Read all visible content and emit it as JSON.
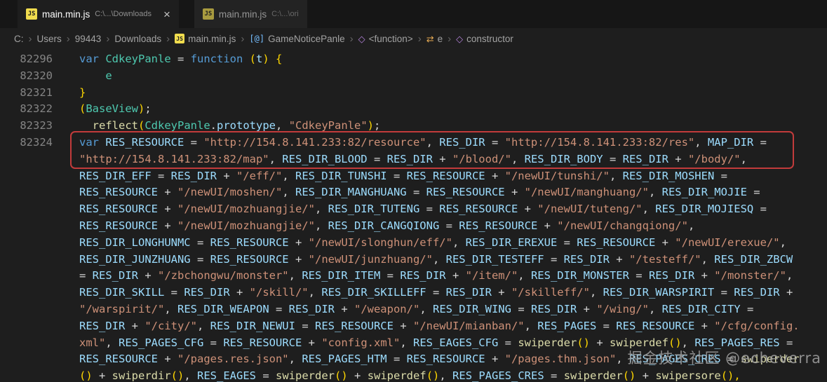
{
  "tabs": [
    {
      "label": "main.min.js",
      "path": "C:\\...\\Downloads",
      "close": "×",
      "active": true,
      "icon": "js"
    },
    {
      "label": "main.min.js",
      "path": "C:\\...\\ori",
      "active": false,
      "icon": "js"
    }
  ],
  "icons": {
    "js": "JS",
    "class": "[@]",
    "cube": "◇",
    "symbol": "⇄"
  },
  "breadcrumb": {
    "separator": "›",
    "items": [
      {
        "label": "C:"
      },
      {
        "label": "Users"
      },
      {
        "label": "99443"
      },
      {
        "label": "Downloads"
      },
      {
        "label": "main.min.js",
        "icon": "js"
      },
      {
        "label": "GameNoticePanle",
        "icon": "class"
      },
      {
        "label": "<function>",
        "icon": "cube"
      },
      {
        "label": "e",
        "icon": "symbol"
      },
      {
        "label": "constructor",
        "icon": "cube"
      }
    ]
  },
  "code": {
    "lines": [
      {
        "num": "82296",
        "tokens": [
          [
            "kw",
            "var "
          ],
          [
            "cls",
            "CdkeyPanle "
          ],
          [
            "op",
            "= "
          ],
          [
            "kw",
            "function "
          ],
          [
            "br",
            "("
          ],
          [
            "var",
            "t"
          ],
          [
            "br",
            ") "
          ],
          [
            "br",
            "{"
          ]
        ]
      },
      {
        "num": "82320",
        "tokens": [
          [
            "pl",
            "    "
          ],
          [
            "cls",
            "e"
          ]
        ]
      },
      {
        "num": "82321",
        "tokens": [
          [
            "br",
            "}"
          ]
        ]
      },
      {
        "num": "82322",
        "tokens": [
          [
            "br",
            "("
          ],
          [
            "cls",
            "BaseView"
          ],
          [
            "br",
            ")"
          ],
          [
            "pl",
            ";"
          ]
        ]
      },
      {
        "num": "82323",
        "tokens": [
          [
            "fn",
            "__reflect"
          ],
          [
            "br",
            "("
          ],
          [
            "cls",
            "CdkeyPanle"
          ],
          [
            "pl",
            "."
          ],
          [
            "var",
            "prototype"
          ],
          [
            "pl",
            ", "
          ],
          [
            "str",
            "\"CdkeyPanle\""
          ],
          [
            "br",
            ")"
          ],
          [
            "pl",
            ";"
          ]
        ]
      },
      {
        "num": "82324",
        "tokens": [
          [
            "kw",
            "var "
          ],
          [
            "var",
            "RES_RESOURCE "
          ],
          [
            "op",
            "= "
          ],
          [
            "str",
            "\"http://154.8.141.233:82/resource\""
          ],
          [
            "pl",
            ", "
          ],
          [
            "var",
            "RES_DIR "
          ],
          [
            "op",
            "= "
          ],
          [
            "str",
            "\"http://154.8.141.233:82/res\""
          ],
          [
            "pl",
            ", "
          ],
          [
            "var",
            "MAP_DIR "
          ],
          [
            "op",
            "="
          ]
        ]
      },
      {
        "num": "",
        "tokens": [
          [
            "str",
            "\"http://154.8.141.233:82/map\""
          ],
          [
            "pl",
            ", "
          ],
          [
            "var",
            "RES_DIR_BLOOD "
          ],
          [
            "op",
            "= "
          ],
          [
            "var",
            "RES_DIR "
          ],
          [
            "op",
            "+ "
          ],
          [
            "str",
            "\"/blood/\""
          ],
          [
            "pl",
            ", "
          ],
          [
            "var",
            "RES_DIR_BODY "
          ],
          [
            "op",
            "= "
          ],
          [
            "var",
            "RES_DIR "
          ],
          [
            "op",
            "+ "
          ],
          [
            "str",
            "\"/body/\""
          ],
          [
            "pl",
            ","
          ]
        ]
      },
      {
        "num": "",
        "tokens": [
          [
            "var",
            "RES_DIR_EFF "
          ],
          [
            "op",
            "= "
          ],
          [
            "var",
            "RES_DIR "
          ],
          [
            "op",
            "+ "
          ],
          [
            "str",
            "\"/eff/\""
          ],
          [
            "pl",
            ", "
          ],
          [
            "var",
            "RES_DIR_TUNSHI "
          ],
          [
            "op",
            "= "
          ],
          [
            "var",
            "RES_RESOURCE "
          ],
          [
            "op",
            "+ "
          ],
          [
            "str",
            "\"/newUI/tunshi/\""
          ],
          [
            "pl",
            ", "
          ],
          [
            "var",
            "RES_DIR_MOSHEN "
          ],
          [
            "op",
            "="
          ]
        ]
      },
      {
        "num": "",
        "tokens": [
          [
            "var",
            "RES_RESOURCE "
          ],
          [
            "op",
            "+ "
          ],
          [
            "str",
            "\"/newUI/moshen/\""
          ],
          [
            "pl",
            ", "
          ],
          [
            "var",
            "RES_DIR_MANGHUANG "
          ],
          [
            "op",
            "= "
          ],
          [
            "var",
            "RES_RESOURCE "
          ],
          [
            "op",
            "+ "
          ],
          [
            "str",
            "\"/newUI/manghuang/\""
          ],
          [
            "pl",
            ", "
          ],
          [
            "var",
            "RES_DIR_MOJIE "
          ],
          [
            "op",
            "="
          ]
        ]
      },
      {
        "num": "",
        "tokens": [
          [
            "var",
            "RES_RESOURCE "
          ],
          [
            "op",
            "+ "
          ],
          [
            "str",
            "\"/newUI/mozhuangjie/\""
          ],
          [
            "pl",
            ", "
          ],
          [
            "var",
            "RES_DIR_TUTENG "
          ],
          [
            "op",
            "= "
          ],
          [
            "var",
            "RES_RESOURCE "
          ],
          [
            "op",
            "+ "
          ],
          [
            "str",
            "\"/newUI/tuteng/\""
          ],
          [
            "pl",
            ", "
          ],
          [
            "var",
            "RES_DIR_MOJIESQ "
          ],
          [
            "op",
            "="
          ]
        ]
      },
      {
        "num": "",
        "tokens": [
          [
            "var",
            "RES_RESOURCE "
          ],
          [
            "op",
            "+ "
          ],
          [
            "str",
            "\"/newUI/mozhuangjie/\""
          ],
          [
            "pl",
            ", "
          ],
          [
            "var",
            "RES_DIR_CANGQIONG "
          ],
          [
            "op",
            "= "
          ],
          [
            "var",
            "RES_RESOURCE "
          ],
          [
            "op",
            "+ "
          ],
          [
            "str",
            "\"/newUI/changqiong/\""
          ],
          [
            "pl",
            ","
          ]
        ]
      },
      {
        "num": "",
        "tokens": [
          [
            "var",
            "RES_DIR_LONGHUNMC "
          ],
          [
            "op",
            "= "
          ],
          [
            "var",
            "RES_RESOURCE "
          ],
          [
            "op",
            "+ "
          ],
          [
            "str",
            "\"/newUI/slonghun/eff/\""
          ],
          [
            "pl",
            ", "
          ],
          [
            "var",
            "RES_DIR_EREXUE "
          ],
          [
            "op",
            "= "
          ],
          [
            "var",
            "RES_RESOURCE "
          ],
          [
            "op",
            "+ "
          ],
          [
            "str",
            "\"/newUI/erexue/\""
          ],
          [
            "pl",
            ","
          ]
        ]
      },
      {
        "num": "",
        "tokens": [
          [
            "var",
            "RES_DIR_JUNZHUANG "
          ],
          [
            "op",
            "= "
          ],
          [
            "var",
            "RES_RESOURCE "
          ],
          [
            "op",
            "+ "
          ],
          [
            "str",
            "\"/newUI/junzhuang/\""
          ],
          [
            "pl",
            ", "
          ],
          [
            "var",
            "RES_DIR_TESTEFF "
          ],
          [
            "op",
            "= "
          ],
          [
            "var",
            "RES_DIR "
          ],
          [
            "op",
            "+ "
          ],
          [
            "str",
            "\"/testeff/\""
          ],
          [
            "pl",
            ", "
          ],
          [
            "var",
            "RES_DIR_ZBCW"
          ]
        ]
      },
      {
        "num": "",
        "tokens": [
          [
            "op",
            "= "
          ],
          [
            "var",
            "RES_DIR "
          ],
          [
            "op",
            "+ "
          ],
          [
            "str",
            "\"/zbchongwu/monster\""
          ],
          [
            "pl",
            ", "
          ],
          [
            "var",
            "RES_DIR_ITEM "
          ],
          [
            "op",
            "= "
          ],
          [
            "var",
            "RES_DIR "
          ],
          [
            "op",
            "+ "
          ],
          [
            "str",
            "\"/item/\""
          ],
          [
            "pl",
            ", "
          ],
          [
            "var",
            "RES_DIR_MONSTER "
          ],
          [
            "op",
            "= "
          ],
          [
            "var",
            "RES_DIR "
          ],
          [
            "op",
            "+ "
          ],
          [
            "str",
            "\"/monster/\""
          ],
          [
            "pl",
            ","
          ]
        ]
      },
      {
        "num": "",
        "tokens": [
          [
            "var",
            "RES_DIR_SKILL "
          ],
          [
            "op",
            "= "
          ],
          [
            "var",
            "RES_DIR "
          ],
          [
            "op",
            "+ "
          ],
          [
            "str",
            "\"/skill/\""
          ],
          [
            "pl",
            ", "
          ],
          [
            "var",
            "RES_DIR_SKILLEFF "
          ],
          [
            "op",
            "= "
          ],
          [
            "var",
            "RES_DIR "
          ],
          [
            "op",
            "+ "
          ],
          [
            "str",
            "\"/skilleff/\""
          ],
          [
            "pl",
            ", "
          ],
          [
            "var",
            "RES_DIR_WARSPIRIT "
          ],
          [
            "op",
            "= "
          ],
          [
            "var",
            "RES_DIR "
          ],
          [
            "op",
            "+"
          ]
        ]
      },
      {
        "num": "",
        "tokens": [
          [
            "str",
            "\"/warspirit/\""
          ],
          [
            "pl",
            ", "
          ],
          [
            "var",
            "RES_DIR_WEAPON "
          ],
          [
            "op",
            "= "
          ],
          [
            "var",
            "RES_DIR "
          ],
          [
            "op",
            "+ "
          ],
          [
            "str",
            "\"/weapon/\""
          ],
          [
            "pl",
            ", "
          ],
          [
            "var",
            "RES_DIR_WING "
          ],
          [
            "op",
            "= "
          ],
          [
            "var",
            "RES_DIR "
          ],
          [
            "op",
            "+ "
          ],
          [
            "str",
            "\"/wing/\""
          ],
          [
            "pl",
            ", "
          ],
          [
            "var",
            "RES_DIR_CITY "
          ],
          [
            "op",
            "="
          ]
        ]
      },
      {
        "num": "",
        "tokens": [
          [
            "var",
            "RES_DIR "
          ],
          [
            "op",
            "+ "
          ],
          [
            "str",
            "\"/city/\""
          ],
          [
            "pl",
            ", "
          ],
          [
            "var",
            "RES_DIR_NEWUI "
          ],
          [
            "op",
            "= "
          ],
          [
            "var",
            "RES_RESOURCE "
          ],
          [
            "op",
            "+ "
          ],
          [
            "str",
            "\"/newUI/mianban/\""
          ],
          [
            "pl",
            ", "
          ],
          [
            "var",
            "RES_PAGES "
          ],
          [
            "op",
            "= "
          ],
          [
            "var",
            "RES_RESOURCE "
          ],
          [
            "op",
            "+ "
          ],
          [
            "str",
            "\"/cfg/config."
          ]
        ]
      },
      {
        "num": "",
        "tokens": [
          [
            "str",
            "xml\""
          ],
          [
            "pl",
            ", "
          ],
          [
            "var",
            "RES_PAGES_CFG "
          ],
          [
            "op",
            "= "
          ],
          [
            "var",
            "RES_RESOURCE "
          ],
          [
            "op",
            "+ "
          ],
          [
            "str",
            "\"config.xml\""
          ],
          [
            "pl",
            ", "
          ],
          [
            "var",
            "RES_EAGES_CFG "
          ],
          [
            "op",
            "= "
          ],
          [
            "fn",
            "swiperder"
          ],
          [
            "br",
            "()"
          ],
          [
            "op",
            " + "
          ],
          [
            "fn",
            "swiperdef"
          ],
          [
            "br",
            "()"
          ],
          [
            "pl",
            ", "
          ],
          [
            "var",
            "RES_PAGES_RES "
          ],
          [
            "op",
            "="
          ]
        ]
      },
      {
        "num": "",
        "tokens": [
          [
            "var",
            "RES_RESOURCE "
          ],
          [
            "op",
            "+ "
          ],
          [
            "str",
            "\"/pages.res.json\""
          ],
          [
            "pl",
            ", "
          ],
          [
            "var",
            "RES_PAGES_HTM "
          ],
          [
            "op",
            "= "
          ],
          [
            "var",
            "RES_RESOURCE "
          ],
          [
            "op",
            "+ "
          ],
          [
            "str",
            "\"/pages.thm.json\""
          ],
          [
            "pl",
            ", "
          ],
          [
            "var",
            "RES_PAGES_CRES "
          ],
          [
            "op",
            "= "
          ],
          [
            "fn",
            "swiperder"
          ]
        ]
      },
      {
        "num": "",
        "tokens": [
          [
            "br",
            "()"
          ],
          [
            "op",
            " + "
          ],
          [
            "fn",
            "swiperdir"
          ],
          [
            "br",
            "()"
          ],
          [
            "pl",
            ", "
          ],
          [
            "var",
            "RES_EAGES "
          ],
          [
            "op",
            "= "
          ],
          [
            "fn",
            "swiperder"
          ],
          [
            "br",
            "()"
          ],
          [
            "op",
            " + "
          ],
          [
            "fn",
            "swiperdef"
          ],
          [
            "br",
            "()"
          ],
          [
            "pl",
            ", "
          ],
          [
            "var",
            "RES_PAGES_CRES "
          ],
          [
            "op",
            "= "
          ],
          [
            "fn",
            "swiperder"
          ],
          [
            "br",
            "()"
          ],
          [
            "op",
            " + "
          ],
          [
            "fn",
            "swipersore"
          ],
          [
            "br",
            "(),"
          ]
        ]
      }
    ]
  },
  "watermark": {
    "text": "掘金技术社区 @echeverra"
  },
  "colors": {
    "editor_bg": "#1e1e1e",
    "tabbar_bg": "#161616",
    "keyword": "#569cd6",
    "class_name": "#4ec9b0",
    "function_name": "#dcdcaa",
    "variable": "#9cdcfe",
    "string": "#ce9178",
    "default_text": "#d4d4d4",
    "bracket": "#ffd700",
    "line_number": "#858585",
    "annotation_box": "#c23b3b",
    "js_icon_bg": "#f0dc4e"
  }
}
